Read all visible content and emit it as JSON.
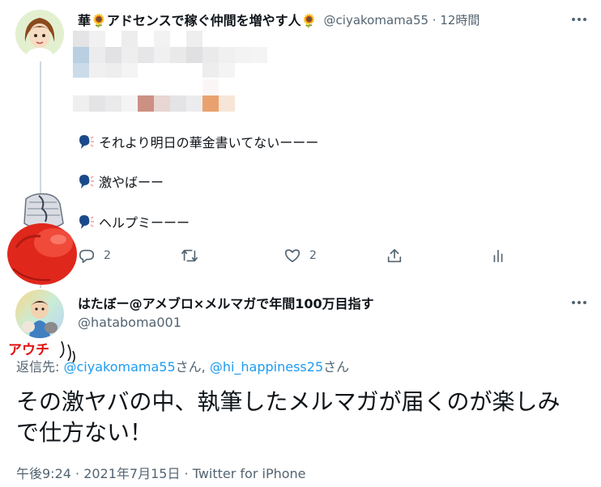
{
  "tweet1": {
    "name": "華🌻アドセンスで稼ぐ仲間を増やす人🌻",
    "handle": "@ciyakomama55 · 12時間",
    "lines": [
      "それより明日の華金書いてないーーー",
      "激やばーー",
      "ヘルプミーーー"
    ],
    "reply_count": "2",
    "like_count": "2",
    "icons": [
      "speech-icon",
      "reply-icon",
      "retweet-icon",
      "like-icon",
      "share-icon",
      "analytics-icon",
      "more-icon"
    ]
  },
  "tweet2": {
    "name": "はたぼー@アメブロ×メルマガで年間100万目指す",
    "handle": "@hataboma001",
    "replying_label": "返信先: ",
    "mention1": "@ciyakomama55",
    "san1": "さん, ",
    "mention2": "@hi_happiness25",
    "san2": "さん",
    "body_line1": "その激ヤバの中、執筆したメルマガが届くのが楽しみ",
    "body_line2": "で仕方ない！",
    "meta": "午後9:24 · 2021年7月15日 · Twitter for iPhone"
  },
  "overlay": {
    "ouch": "アウチ",
    "glove_color": "#e0271c",
    "accent": "#1d9bf0",
    "muted": "#536471"
  }
}
